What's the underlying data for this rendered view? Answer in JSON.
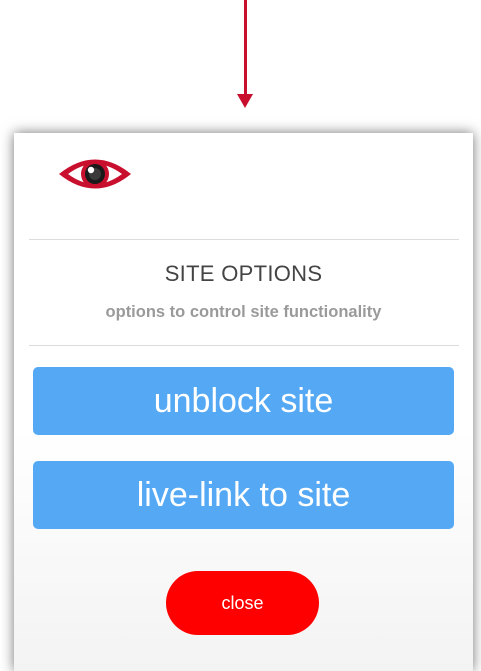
{
  "pointer": {
    "icon": "down-arrow-icon",
    "color": "#c8102e"
  },
  "dialog": {
    "logo_icon": "eye-icon",
    "logo_color": "#c8102e",
    "title": "SITE OPTIONS",
    "subtitle": "options to control site functionality",
    "buttons": {
      "unblock_label": "unblock site",
      "livelink_label": "live-link to site",
      "close_label": "close"
    },
    "colors": {
      "primary_button": "#55a9f4",
      "close_button": "#ff0000"
    }
  }
}
